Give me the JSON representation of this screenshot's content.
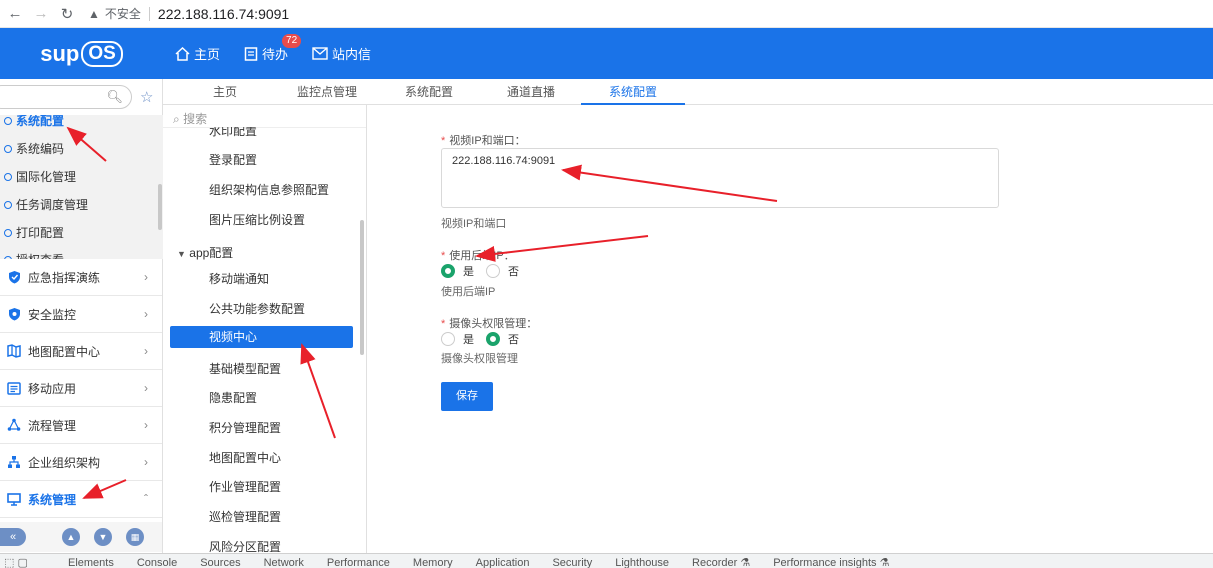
{
  "browser": {
    "security_label": "不安全",
    "url": "222.188.116.74:9091"
  },
  "header": {
    "logo_text": "sup",
    "logo_badge": "OS",
    "nav": [
      {
        "label": "主页",
        "icon": "home-icon"
      },
      {
        "label": "待办",
        "icon": "todo-icon",
        "badge": "72"
      },
      {
        "label": "站内信",
        "icon": "mail-icon"
      }
    ]
  },
  "sidebar": {
    "search_placeholder": "",
    "sub_items": [
      "系统配置",
      "系统编码",
      "国际化管理",
      "任务调度管理",
      "打印配置",
      "授权查看"
    ],
    "active_sub": 0,
    "menu": [
      {
        "label": "应急指挥演练",
        "icon": "shield-check-icon"
      },
      {
        "label": "安全监控",
        "icon": "shield-icon"
      },
      {
        "label": "地图配置中心",
        "icon": "map-icon"
      },
      {
        "label": "移动应用",
        "icon": "mobile-app-icon"
      },
      {
        "label": "流程管理",
        "icon": "flow-icon"
      },
      {
        "label": "企业组织架构",
        "icon": "org-chart-icon"
      },
      {
        "label": "系统管理",
        "icon": "monitor-icon",
        "expanded": true
      }
    ],
    "bottom_icons": [
      "collapse-icon",
      "arrow-up-icon",
      "arrow-down-icon",
      "grid-icon"
    ]
  },
  "tabs": [
    {
      "label": "主页"
    },
    {
      "label": "监控点管理"
    },
    {
      "label": "系统配置"
    },
    {
      "label": "通道直播"
    },
    {
      "label": "系统配置",
      "active": true
    }
  ],
  "tree": {
    "search_placeholder": "搜索",
    "items": [
      "水印配置",
      "登录配置",
      "组织架构信息参照配置",
      "图片压缩比例设置"
    ],
    "group": "app配置",
    "group_items": [
      "移动端通知",
      "公共功能参数配置",
      "视频中心",
      "基础模型配置",
      "隐患配置",
      "积分管理配置",
      "地图配置中心",
      "作业管理配置",
      "巡检管理配置",
      "风险分区配置"
    ],
    "selected": "视频中心"
  },
  "form": {
    "field1": {
      "label": "视频IP和端口：",
      "value": "222.188.116.74:9091",
      "hint": "视频IP和端口"
    },
    "field2": {
      "label": "使用后端IP：",
      "options": [
        "是",
        "否"
      ],
      "selected": "是",
      "hint": "使用后端IP"
    },
    "field3": {
      "label": "摄像头权限管理：",
      "options": [
        "是",
        "否"
      ],
      "selected": "否",
      "hint": "摄像头权限管理"
    },
    "save_label": "保存"
  },
  "devtools": {
    "tabs": [
      "Elements",
      "Console",
      "Sources",
      "Network",
      "Performance",
      "Memory",
      "Application",
      "Security",
      "Lighthouse",
      "Recorder ⚗",
      "Performance insights ⚗"
    ]
  },
  "colors": {
    "primary": "#1a73e8",
    "radio_checked": "#1aa36b",
    "annotation": "#e8202a"
  }
}
